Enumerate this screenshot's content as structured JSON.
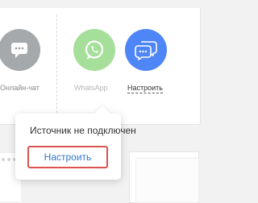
{
  "channels": [
    {
      "label": "Онлайн-чат",
      "icon": "chat-bubble-icon",
      "color": "#a5a9ab"
    },
    {
      "label": "WhatsApp",
      "icon": "whatsapp-icon",
      "color": "#a6df9a"
    },
    {
      "label": "Настроить",
      "icon": "chat-bubbles-icon",
      "color": "#4f86f7"
    }
  ],
  "popup": {
    "message": "Источник не подключен",
    "button_label": "Настроить",
    "button_border_color": "#d9534f",
    "button_text_color": "#2f75cf"
  }
}
